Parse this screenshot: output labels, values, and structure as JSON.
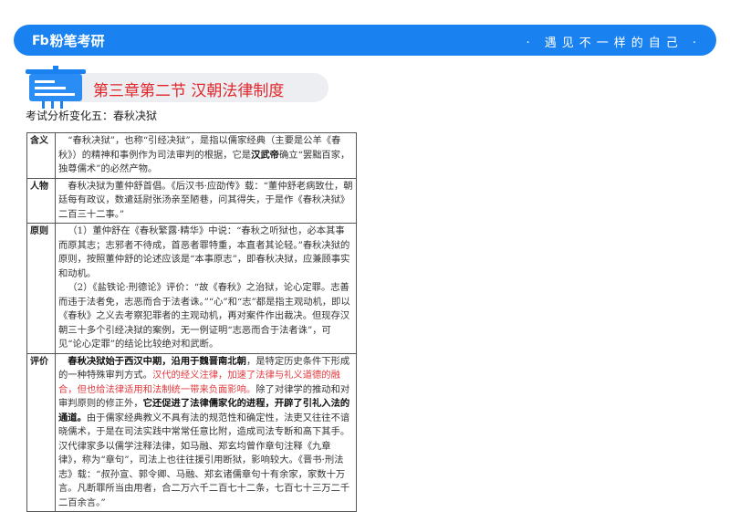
{
  "header": {
    "logo_mark": "Fb",
    "logo_text": "粉笔考研",
    "slogan": "· 遇见不一样的自己 ·",
    "brand_color": "#1a82f0"
  },
  "title": "第三章第二节 汉朝法律制度",
  "subtitle": "考试分析变化五：春秋决狱",
  "rows": [
    {
      "label": "含义",
      "paras": [
        [
          {
            "t": "“春秋决狱”，也称“引经决狱”，是指以儒家经典（主要是公羊《春秋》）的精神和事例作为司法审判的根据，它是",
            "s": ""
          },
          {
            "t": "汉武帝",
            "s": "b"
          },
          {
            "t": "确立“罢黜百家，独尊儒术”的必然产物。",
            "s": ""
          }
        ]
      ]
    },
    {
      "label": "人物",
      "paras": [
        [
          {
            "t": "春秋决狱为董仲舒首倡。《后汉书·应劭传》载：“董仲舒老病致仕，朝廷每有政议，数遣廷尉张汤亲至陋巷，问其得失，于是作《春秋决狱》二百三十二事。”",
            "s": ""
          }
        ]
      ]
    },
    {
      "label": "原则",
      "paras": [
        [
          {
            "t": "（1）董仲舒在《春秋繁露·精华》中说：“春秋之听狱也，必本其事而原其志；志邪者不待成，首恶者罪特重，本直者其论轻。”春秋决狱的原则，按照董仲舒的论述应该是“本事原志”，即春秋决狱，应兼顾事实和动机。",
            "s": ""
          }
        ],
        [
          {
            "t": "（2）《盐铁论·刑德论》评价：“故《春秋》之治狱，论心定罪。志善而违于法者免，志恶而合于法者诛。”“心”和“志”都是指主观动机，即以《春秋》之义去考察犯罪者的主观动机，再对案件作出裁决。但现存汉朝三十多个引经决狱的案例，无一例证明“志恶而合于法者诛”，可见“论心定罪”的结论比较绝对和武断。",
            "s": ""
          }
        ]
      ]
    },
    {
      "label": "评价",
      "paras": [
        [
          {
            "t": "春秋决狱始于西汉中期，沿用于魏晋南北朝",
            "s": "b"
          },
          {
            "t": "，是特定历史条件下形成的一种特殊审判方式。",
            "s": ""
          },
          {
            "t": "汉代的经义注律，加速了法律与礼义道德的融合，但也给法律适用和法制统一带来负面影响。",
            "s": "r"
          },
          {
            "t": "除了对律学的推动和对审判原则的修正外，",
            "s": ""
          },
          {
            "t": "它还促进了法律儒家化的进程，开辟了引礼入法的通道。",
            "s": "b"
          },
          {
            "t": "由于儒家经典教义不具有法的规范性和确定性，法吏又往往不谙晓儒术，于是在司法实践中常常任意比附，造成司法专断和高下其手。汉代律家多以儒学注释法律，如马融、郑玄均曾作章句注释《九章律》，称为“章句”，司法上也往往援引用断狱，影响较大。《晋书·刑法志》载：“叔孙宣、郭令卿、马融、郑玄诸儒章句十有余家，家数十万言。凡断罪所当由用者，合二万六千二百七十二条，七百七十三万二千二百余言。”",
            "s": ""
          }
        ]
      ]
    }
  ]
}
